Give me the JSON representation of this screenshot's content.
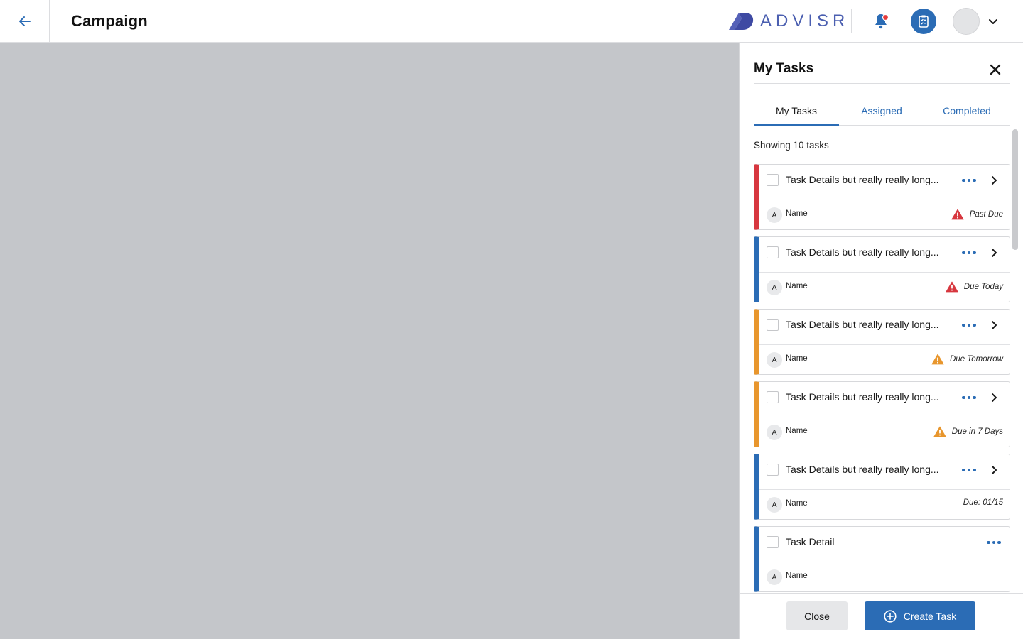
{
  "header": {
    "title": "Campaign",
    "logo_text": "ADVISR"
  },
  "drawer": {
    "title": "My Tasks",
    "tabs": [
      {
        "label": "My Tasks",
        "active": true
      },
      {
        "label": "Assigned",
        "active": false
      },
      {
        "label": "Completed",
        "active": false
      }
    ],
    "count_label": "Showing 10 tasks",
    "tasks": [
      {
        "title": "Task Details but really really long...",
        "assignee_initial": "A",
        "assignee": "Name",
        "due": "Past Due",
        "status": "overdue",
        "warning_icon": "warning-red"
      },
      {
        "title": "Task Details but really really long...",
        "assignee_initial": "A",
        "assignee": "Name",
        "due": "Due Today",
        "status": "today",
        "warning_icon": "warning-red"
      },
      {
        "title": "Task Details but really really long...",
        "assignee_initial": "A",
        "assignee": "Name",
        "due": "Due Tomorrow",
        "status": "soon",
        "warning_icon": "warning-orange"
      },
      {
        "title": "Task Details but really really long...",
        "assignee_initial": "A",
        "assignee": "Name",
        "due": "Due in 7 Days",
        "status": "soon",
        "warning_icon": "warning-orange"
      },
      {
        "title": "Task Details but really really long...",
        "assignee_initial": "A",
        "assignee": "Name",
        "due": "Due: 01/15",
        "status": "normal",
        "warning_icon": ""
      },
      {
        "title": "Task Detail",
        "assignee_initial": "A",
        "assignee": "Name",
        "due": "",
        "status": "normal",
        "warning_icon": ""
      }
    ],
    "footer": {
      "close_label": "Close",
      "create_label": "Create Task"
    }
  },
  "colors": {
    "accent": "#2b6cb5",
    "overdue": "#d7373f",
    "soon": "#e8962d",
    "normal": "#2b6cb5",
    "backdrop": "#c4c6ca",
    "logo": "#4b5fb0"
  }
}
